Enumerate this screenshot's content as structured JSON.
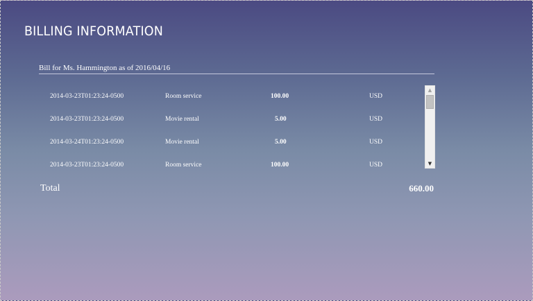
{
  "page": {
    "title": "BILLING INFORMATION",
    "bill_header": "Bill for Ms. Hammington as of 2016/04/16"
  },
  "charges": [
    {
      "date": "2014-03-23T01:23:24-0500",
      "description": "Room service",
      "amount": "100.00",
      "currency": "USD"
    },
    {
      "date": "2014-03-23T01:23:24-0500",
      "description": "Movie rental",
      "amount": "5.00",
      "currency": "USD"
    },
    {
      "date": "2014-03-24T01:23:24-0500",
      "description": "Movie rental",
      "amount": "5.00",
      "currency": "USD"
    },
    {
      "date": "2014-03-23T01:23:24-0500",
      "description": "Room service",
      "amount": "100.00",
      "currency": "USD"
    }
  ],
  "total": {
    "label": "Total",
    "value": "660.00"
  },
  "scrollbar": {
    "up_icon": "▲",
    "down_icon": "▼"
  }
}
